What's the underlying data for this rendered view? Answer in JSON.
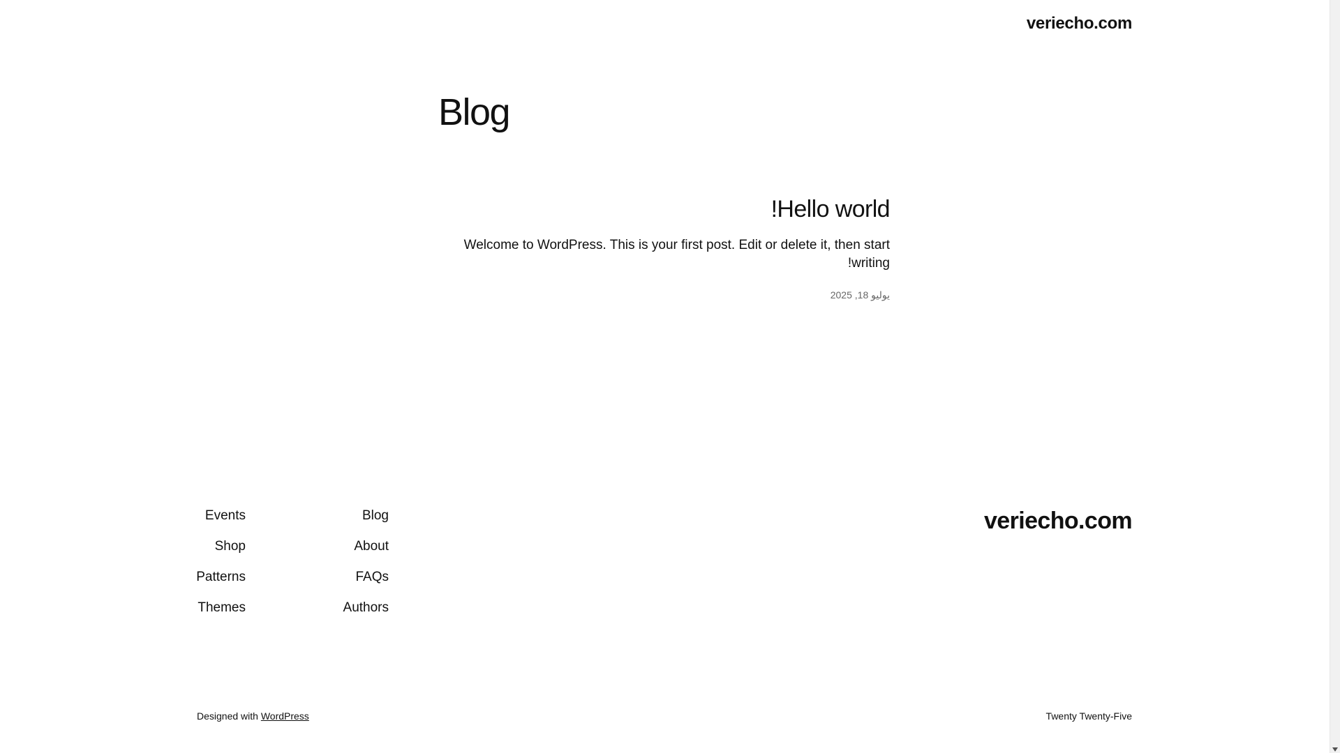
{
  "header": {
    "site_title": "veriecho.com"
  },
  "main": {
    "page_title": "Blog",
    "post": {
      "title": "Hello world!",
      "excerpt": "Welcome to WordPress. This is your first post. Edit or delete it, then start writing!",
      "date": "يوليو 18, 2025"
    }
  },
  "footer": {
    "nav_col_a": [
      "Blog",
      "About",
      "FAQs",
      "Authors"
    ],
    "nav_col_b": [
      "Events",
      "Shop",
      "Patterns",
      "Themes"
    ],
    "site_title": "veriecho.com",
    "credit_prefix": "Designed with ",
    "credit_link": "WordPress",
    "theme_name": "Twenty Twenty-Five"
  }
}
